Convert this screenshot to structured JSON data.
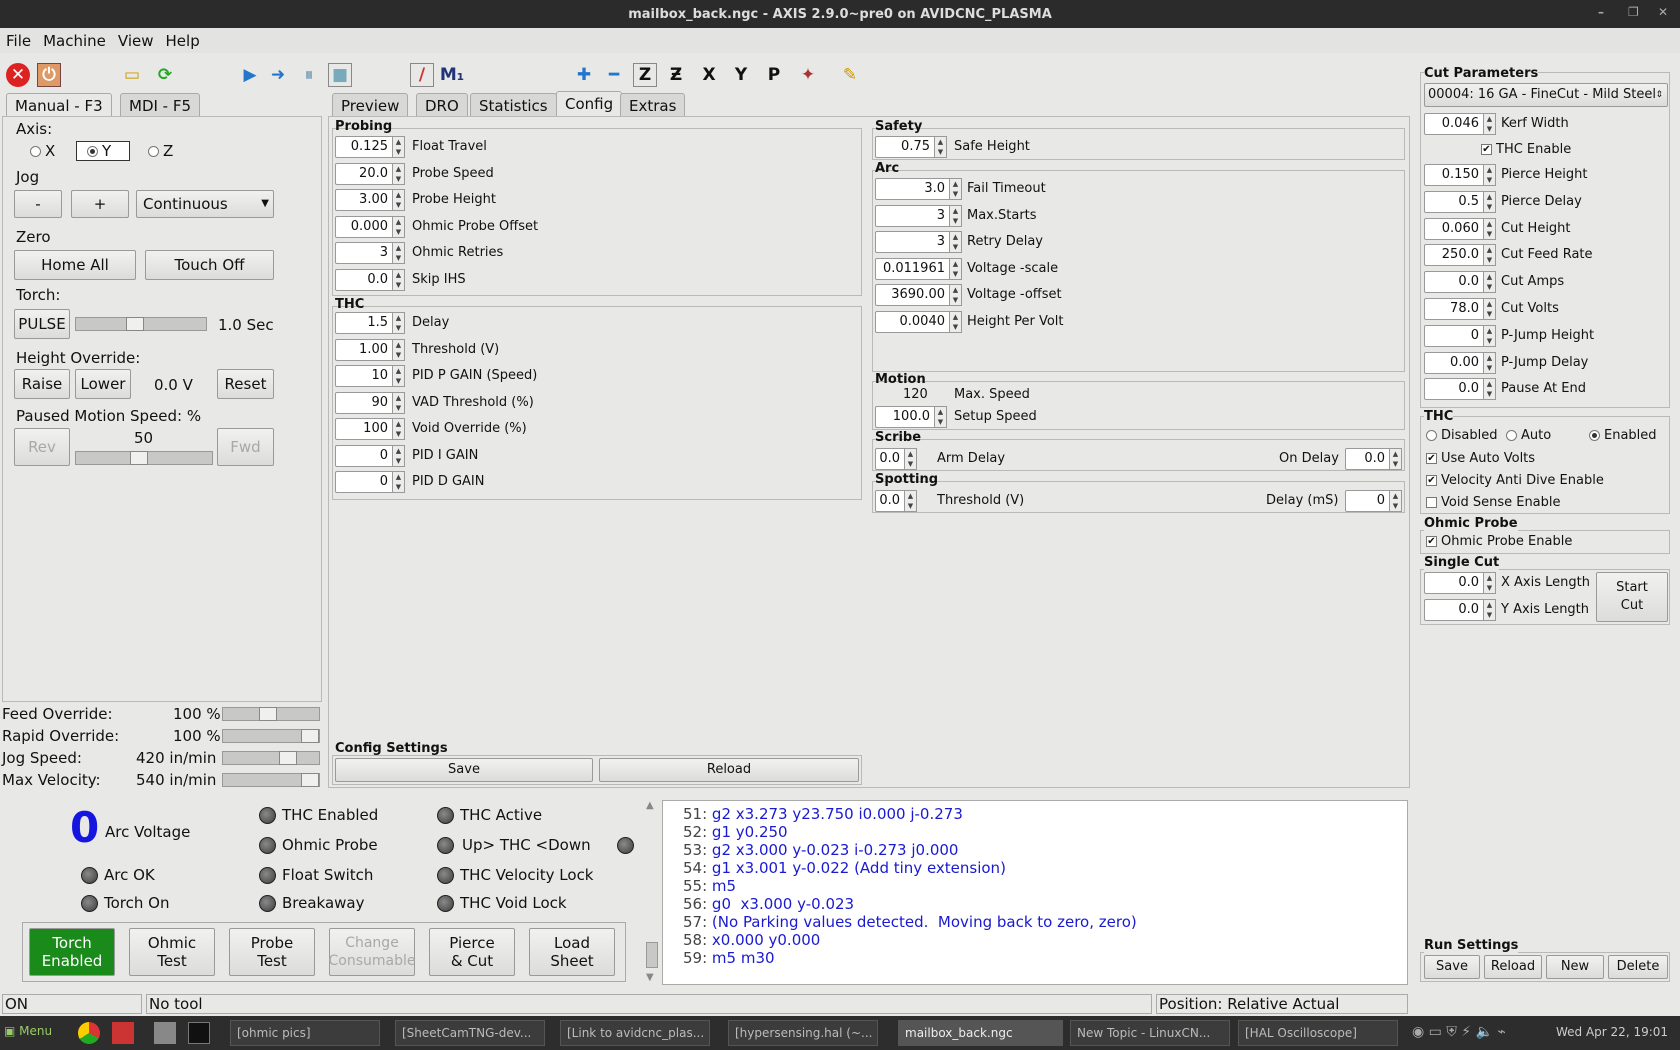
{
  "window": {
    "title": "mailbox_back.ngc - AXIS 2.9.0~pre0 on AVIDCNC_PLASMA"
  },
  "menu": [
    "File",
    "Machine",
    "View",
    "Help"
  ],
  "left_tabs": [
    "Manual - F3",
    "MDI - F5"
  ],
  "center_tabs": [
    "Preview",
    "DRO",
    "Statistics",
    "Config",
    "Extras"
  ],
  "manual": {
    "axis_label": "Axis:",
    "axes": [
      "X",
      "Y",
      "Z"
    ],
    "selected_axis": "Y",
    "jog_label": "Jog",
    "jog_minus": "-",
    "jog_plus": "+",
    "jog_mode": "Continuous",
    "zero_label": "Zero",
    "home_all": "Home All",
    "touch_off": "Touch Off",
    "torch_label": "Torch:",
    "pulse": "PULSE",
    "pulse_time": "1.0 Sec",
    "height_override_label": "Height Override:",
    "raise": "Raise",
    "lower": "Lower",
    "height_value": "0.0 V",
    "reset": "Reset",
    "paused_speed_label": "Paused Motion Speed: %",
    "rev": "Rev",
    "fwd": "Fwd",
    "paused_speed_value": "50"
  },
  "overrides": [
    {
      "label": "Feed Override:",
      "value": "100 %"
    },
    {
      "label": "Rapid Override:",
      "value": "100 %"
    },
    {
      "label": "Jog Speed:",
      "value": "420 in/min"
    },
    {
      "label": "Max Velocity:",
      "value": "540 in/min"
    }
  ],
  "config": {
    "probing": {
      "title": "Probing",
      "rows": [
        {
          "value": "0.125",
          "label": "Float Travel"
        },
        {
          "value": "20.0",
          "label": "Probe Speed"
        },
        {
          "value": "3.00",
          "label": "Probe Height"
        },
        {
          "value": "0.000",
          "label": "Ohmic Probe Offset"
        },
        {
          "value": "3",
          "label": "Ohmic Retries"
        },
        {
          "value": "0.0",
          "label": "Skip IHS"
        }
      ]
    },
    "thc": {
      "title": "THC",
      "rows": [
        {
          "value": "1.5",
          "label": "Delay"
        },
        {
          "value": "1.00",
          "label": "Threshold (V)"
        },
        {
          "value": "10",
          "label": "PID P GAIN (Speed)"
        },
        {
          "value": "90",
          "label": "VAD Threshold (%)"
        },
        {
          "value": "100",
          "label": "Void Override (%)"
        },
        {
          "value": "0",
          "label": "PID I GAIN"
        },
        {
          "value": "0",
          "label": "PID D GAIN"
        }
      ]
    },
    "safety": {
      "title": "Safety",
      "rows": [
        {
          "value": "0.75",
          "label": "Safe Height"
        }
      ]
    },
    "arc": {
      "title": "Arc",
      "rows": [
        {
          "value": "3.0",
          "label": "Fail Timeout"
        },
        {
          "value": "3",
          "label": "Max.Starts"
        },
        {
          "value": "3",
          "label": "Retry Delay"
        },
        {
          "value": "0.011961",
          "label": "Voltage -scale"
        },
        {
          "value": "3690.00",
          "label": "Voltage -offset"
        },
        {
          "value": "0.0040",
          "label": "Height Per Volt"
        }
      ]
    },
    "motion": {
      "title": "Motion",
      "max_speed_value": "120",
      "max_speed_label": "Max. Speed",
      "setup_value": "100.0",
      "setup_label": "Setup Speed"
    },
    "scribe": {
      "title": "Scribe",
      "arm_value": "0.0",
      "arm_label": "Arm Delay",
      "on_label": "On Delay",
      "on_value": "0.0"
    },
    "spotting": {
      "title": "Spotting",
      "thr_value": "0.0",
      "thr_label": "Threshold (V)",
      "delay_label": "Delay (mS)",
      "delay_value": "0"
    },
    "settings": {
      "title": "Config Settings",
      "save": "Save",
      "reload": "Reload"
    }
  },
  "cut": {
    "title": "Cut Parameters",
    "material": "00004: 16 GA - FineCut - Mild Steel",
    "kerf": {
      "value": "0.046",
      "label": "Kerf Width"
    },
    "thc_enable": "THC Enable",
    "rows": [
      {
        "value": "0.150",
        "label": "Pierce Height"
      },
      {
        "value": "0.5",
        "label": "Pierce Delay"
      },
      {
        "value": "0.060",
        "label": "Cut Height"
      },
      {
        "value": "250.0",
        "label": "Cut Feed Rate"
      },
      {
        "value": "0.0",
        "label": "Cut Amps"
      },
      {
        "value": "78.0",
        "label": "Cut Volts"
      },
      {
        "value": "0",
        "label": "P-Jump Height"
      },
      {
        "value": "0.00",
        "label": "P-Jump Delay"
      },
      {
        "value": "0.0",
        "label": "Pause At End"
      }
    ],
    "thc_title": "THC",
    "thc_modes": [
      "Disabled",
      "Auto",
      "Enabled"
    ],
    "use_auto_volts": "Use Auto Volts",
    "vad_enable": "Velocity Anti Dive Enable",
    "void_enable": "Void Sense Enable",
    "ohmic_title": "Ohmic Probe",
    "ohmic_enable": "Ohmic Probe Enable",
    "single_title": "Single Cut",
    "x_value": "0.0",
    "x_label": "X Axis Length",
    "y_value": "0.0",
    "y_label": "Y Axis Length",
    "start_cut": "Start Cut",
    "run_title": "Run Settings",
    "save": "Save",
    "reload": "Reload",
    "new": "New",
    "delete": "Delete"
  },
  "status": {
    "arc_voltage_value": "0",
    "arc_voltage_label": "Arc Voltage",
    "leds": [
      "Arc OK",
      "Torch On",
      "THC Enabled",
      "Ohmic Probe",
      "Float Switch",
      "Breakaway",
      "THC Active",
      "Up> THC <Down",
      "THC Velocity Lock",
      "THC Void Lock"
    ]
  },
  "buttons": {
    "torch": "Torch Enabled",
    "ohmic": "Ohmic Test",
    "probe": "Probe Test",
    "change": "Change Consumable",
    "pierce": "Pierce & Cut",
    "load": "Load Sheet"
  },
  "gcode": [
    {
      "n": "51:",
      "t": "g2 x3.273 y23.750 i0.000 j-0.273"
    },
    {
      "n": "52:",
      "t": "g1 y0.250"
    },
    {
      "n": "53:",
      "t": "g2 x3.000 y-0.023 i-0.273 j0.000"
    },
    {
      "n": "54:",
      "t": "g1 x3.001 y-0.022 (Add tiny extension)"
    },
    {
      "n": "55:",
      "t": "m5"
    },
    {
      "n": "56:",
      "t": "g0  x3.000 y-0.023"
    },
    {
      "n": "57:",
      "t": "(No Parking values detected.  Moving back to zero, zero)"
    },
    {
      "n": "58:",
      "t": "x0.000 y0.000"
    },
    {
      "n": "59:",
      "t": "m5 m30"
    }
  ],
  "statusbar": {
    "state": "ON",
    "tool": "No tool",
    "position": "Position: Relative Actual"
  },
  "taskbar": {
    "menu": "Menu",
    "tasks": [
      "[ohmic pics]",
      "[SheetCamTNG-dev...",
      "[Link to avidcnc_plas...",
      "[hypersensing.hal (~...",
      "mailbox_back.ngc",
      "New Topic - LinuxCN...",
      "[HAL Oscilloscope]"
    ],
    "clock": "Wed Apr 22, 19:01"
  }
}
